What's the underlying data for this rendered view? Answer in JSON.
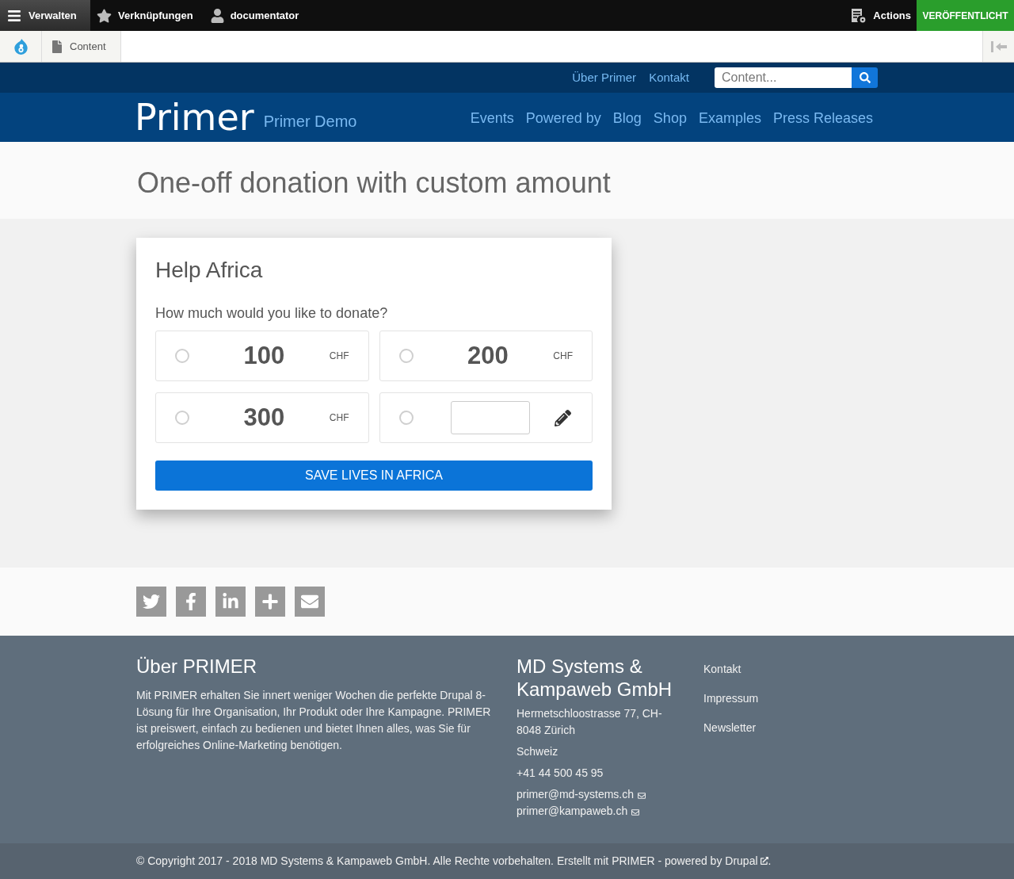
{
  "admin_toolbar": {
    "items": [
      {
        "label": "Verwalten",
        "selected": true
      },
      {
        "label": "Verknüpfungen",
        "selected": false
      },
      {
        "label": "documentator",
        "selected": false
      }
    ],
    "actions": "Actions",
    "status": "VERÖFFENTLICHT"
  },
  "secondary_toolbar": {
    "tab": "Content"
  },
  "header": {
    "top_links": [
      "Über Primer",
      "Kontakt"
    ],
    "search": {
      "placeholder": "Content..."
    },
    "logo": "Primer",
    "site_name": "Primer Demo",
    "nav": [
      "Events",
      "Powered by",
      "Blog",
      "Shop",
      "Examples",
      "Press Releases"
    ]
  },
  "page_title": "One-off donation with custom amount",
  "donation_form": {
    "title": "Help Africa",
    "question": "How much would you like to donate?",
    "options": [
      {
        "kind": "amount",
        "amount": "100",
        "currency": "CHF",
        "selected": false
      },
      {
        "kind": "amount",
        "amount": "200",
        "currency": "CHF",
        "selected": false
      },
      {
        "kind": "amount",
        "amount": "300",
        "currency": "CHF",
        "selected": false
      },
      {
        "kind": "custom",
        "selected": false
      }
    ],
    "submit": "SAVE LIVES IN AFRICA"
  },
  "footer": {
    "about": {
      "title": "Über PRIMER",
      "text": "Mit PRIMER erhalten Sie innert weniger Wochen die perfekte Drupal 8-Lösung für Ihre Organisation, Ihr Produkt oder Ihre Kampagne. PRIMER ist preiswert, einfach zu bedienen und bietet Ihnen alles, was Sie für erfolgreiches Online-Marketing benötigen."
    },
    "company": {
      "title": "MD Systems & Kampaweb GmbH",
      "lines": [
        "Hermetschloostrasse 77, CH-8048 Zürich",
        "Schweiz",
        "+41 44 500 45 95"
      ],
      "emails": [
        "primer@md-systems.ch",
        "primer@kampaweb.ch"
      ]
    },
    "links": [
      "Kontakt",
      "Impressum",
      "Newsletter"
    ]
  },
  "copyright": {
    "text": "© Copyright 2017 - 2018 MD Systems & Kampaweb GmbH. Alle Rechte vorbehalten. Erstellt mit PRIMER - powered by",
    "link": "Drupal",
    "end": "."
  }
}
